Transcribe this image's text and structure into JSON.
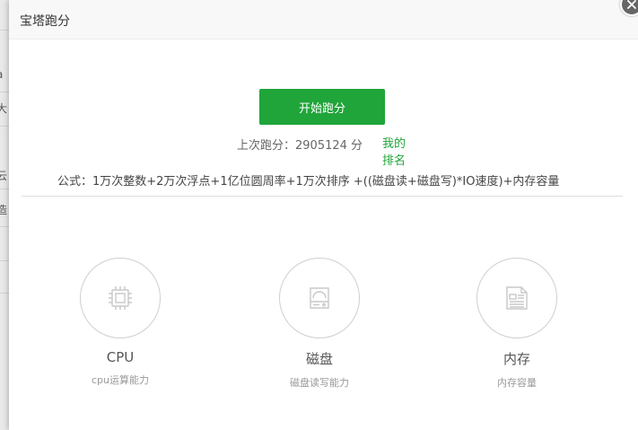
{
  "background": {
    "fragments": [
      "a",
      "大",
      "云",
      "造"
    ]
  },
  "dialog": {
    "title": "宝塔跑分",
    "start_button": "开始跑分",
    "last_score": "上次跑分：2905124 分",
    "my_rank": "我的排名",
    "formula": "公式：1万次整数+2万次浮点+1亿位圆周率+1万次排序 +((磁盘读+磁盘写)*IO速度)+内存容量",
    "items": [
      {
        "name": "CPU",
        "desc": "cpu运算能力",
        "icon": "cpu-chip-icon"
      },
      {
        "name": "磁盘",
        "desc": "磁盘读写能力",
        "icon": "hard-disk-icon"
      },
      {
        "name": "内存",
        "desc": "内存容量",
        "icon": "memory-icon"
      }
    ]
  },
  "colors": {
    "accent": "#20a53a",
    "icon_stroke": "#c8c8c8"
  }
}
